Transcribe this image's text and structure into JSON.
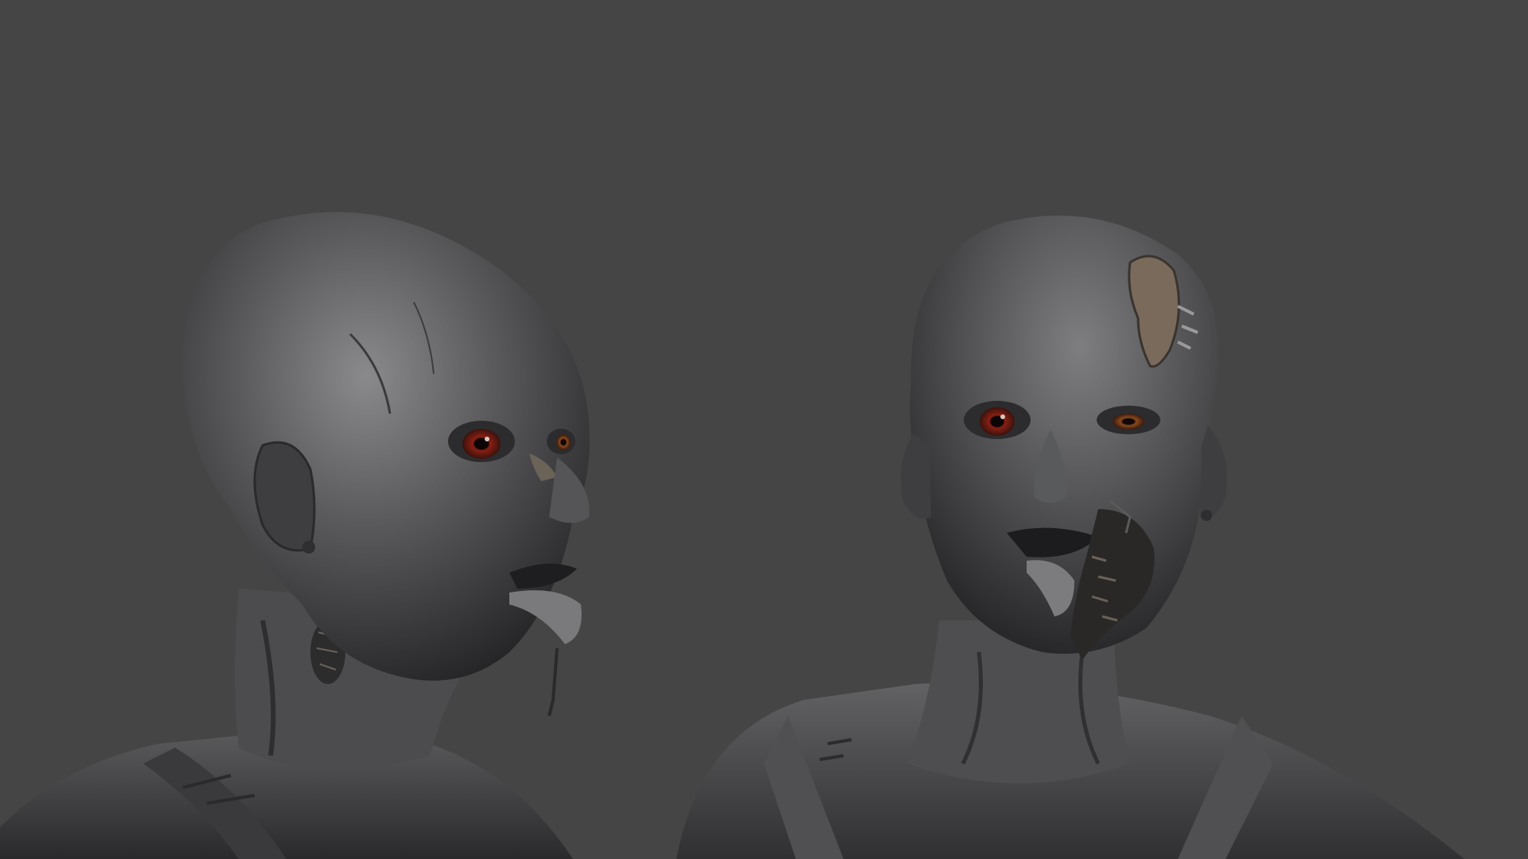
{
  "scene": {
    "description_free": true,
    "background_color": "#454545",
    "sculpt_base_color": "#4a4a4c",
    "sculpt_highlight_color": "#8a8a8d",
    "sculpt_shadow_color": "#1e1e20",
    "eye_iris_color": "#8b1f14",
    "eye_pupil_color": "#0c0505",
    "wound_color": "#6b6258",
    "scalp_patch_color": "#7a6a5c"
  },
  "busts": [
    {
      "name": "three-quarter-view",
      "tongue_out": true
    },
    {
      "name": "front-view",
      "tongue_out": true
    }
  ]
}
